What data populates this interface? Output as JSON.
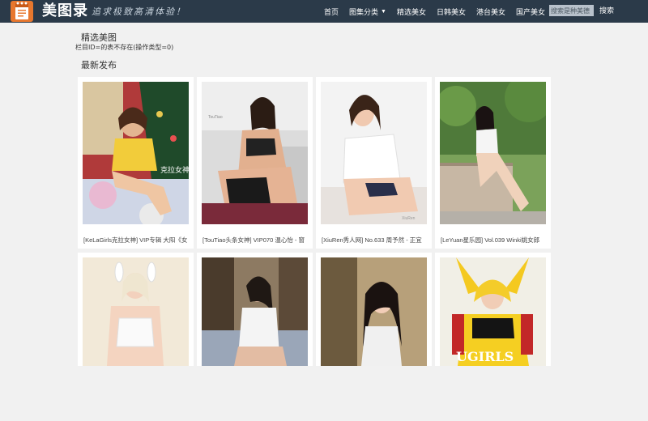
{
  "header": {
    "site_title": "美图录",
    "slogan": "追求极致高清体验！",
    "logo_icon": "notepad-icon",
    "brand_color": "#2b3a49",
    "accent_color": "#e8772e"
  },
  "nav": {
    "items": [
      {
        "label": "首页"
      },
      {
        "label": "图集分类"
      },
      {
        "label": "精选美女"
      },
      {
        "label": "日韩美女"
      },
      {
        "label": "港台美女"
      },
      {
        "label": "国产美女"
      }
    ],
    "dropdown_icon": "caret-down-icon"
  },
  "search": {
    "placeholder": "搜索是种美德",
    "button_label": "搜索"
  },
  "main": {
    "section_title": "精选美图",
    "notice": "栏目ID=的表不存在(操作类型=0)",
    "latest_title": "最新发布",
    "cards": [
      {
        "caption": "[KeLaGirls克拉女神] VIP专辑 大阳《女"
      },
      {
        "caption": "[TouTiao头条女神] VIP070 温心怡 - 窗"
      },
      {
        "caption": "[XiuRen秀人网] No.633 周予然 - 正宜"
      },
      {
        "caption": "[LeYuan星乐园] Vol.039 Winki姚女郎"
      },
      {
        "caption": ""
      },
      {
        "caption": ""
      },
      {
        "caption": ""
      },
      {
        "caption": ""
      }
    ]
  }
}
